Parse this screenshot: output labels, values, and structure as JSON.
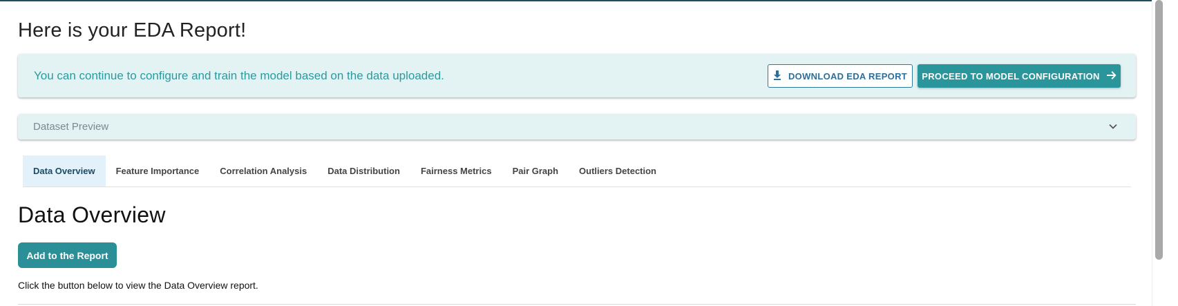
{
  "header": {
    "title": "Here is your EDA Report!"
  },
  "banner": {
    "message": "You can continue to configure and train the model based on the data uploaded.",
    "download_label": "DOWNLOAD EDA REPORT",
    "proceed_label": "PROCEED TO MODEL CONFIGURATION"
  },
  "accordion": {
    "label": "Dataset Preview"
  },
  "tabs": [
    {
      "label": "Data Overview",
      "active": true
    },
    {
      "label": "Feature Importance",
      "active": false
    },
    {
      "label": "Correlation Analysis",
      "active": false
    },
    {
      "label": "Data Distribution",
      "active": false
    },
    {
      "label": "Fairness Metrics",
      "active": false
    },
    {
      "label": "Pair Graph",
      "active": false
    },
    {
      "label": "Outliers Detection",
      "active": false
    }
  ],
  "main": {
    "section_title": "Data Overview",
    "add_button_label": "Add to the Report",
    "hint": "Click the button below to view the Data Overview report."
  },
  "icons": {
    "download": "download-icon",
    "arrow": "arrow-right-icon",
    "chevron": "chevron-down-icon"
  },
  "colors": {
    "accent": "#2a969c",
    "banner_bg": "#e3f3f3",
    "active_tab_bg": "#e3f1fb",
    "outline_button": "#2b6f9a"
  }
}
